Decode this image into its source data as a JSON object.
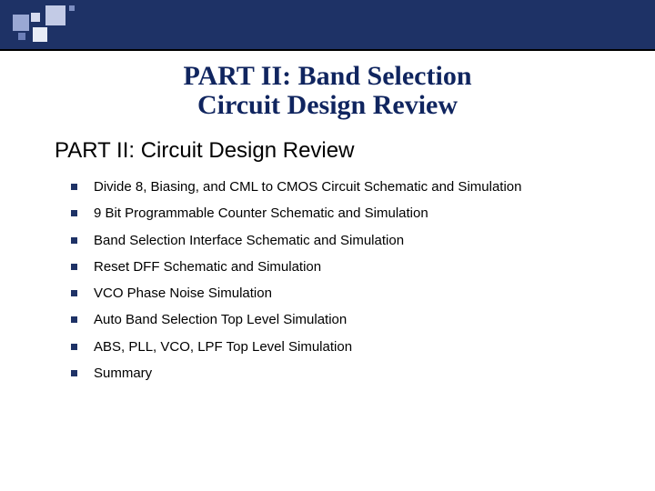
{
  "title": {
    "line1": "PART II: Band Selection",
    "line2": "Circuit Design Review"
  },
  "subtitle": "PART II: Circuit Design Review",
  "items": [
    "Divide 8, Biasing, and CML to CMOS Circuit Schematic and Simulation",
    "9 Bit Programmable Counter Schematic and Simulation",
    "Band Selection Interface Schematic and Simulation",
    "Reset DFF Schematic and Simulation",
    "VCO Phase Noise Simulation",
    "Auto Band Selection Top Level Simulation",
    "ABS, PLL, VCO, LPF Top Level Simulation",
    "Summary"
  ]
}
